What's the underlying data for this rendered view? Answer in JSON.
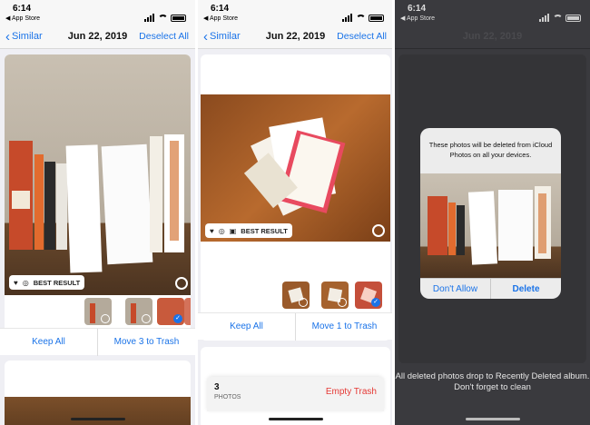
{
  "status": {
    "time": "6:14",
    "back_app": "◀ App Store"
  },
  "nav": {
    "back_label": "Similar",
    "title": "Jun 22, 2019",
    "right_label": "Deselect All"
  },
  "panel1": {
    "best_label": "BEST RESULT",
    "keep_label": "Keep All",
    "trash_label": "Move 3 to Trash"
  },
  "panel2": {
    "best_label": "BEST RESULT",
    "keep_label": "Keep All",
    "trash_label": "Move 1 to Trash",
    "count": "3",
    "count_label": "PHOTOS",
    "empty_label": "Empty Trash"
  },
  "panel3": {
    "alert_message": "These photos will be deleted from iCloud Photos on all your devices.",
    "dont_allow": "Don't Allow",
    "delete": "Delete",
    "footer": "All deleted photos drop to Recently Deleted album. Don't forget to clean"
  },
  "colors": {
    "accent": "#1a73e8",
    "destructive": "#e53935"
  }
}
